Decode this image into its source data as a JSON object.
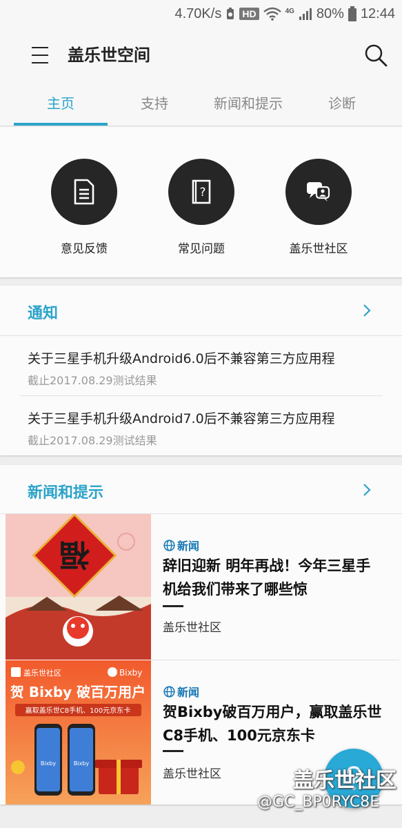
{
  "status_bar": {
    "speed": "4.70K/s",
    "hd": "HD",
    "network": "4G",
    "battery": "80%",
    "time": "12:44"
  },
  "app_bar": {
    "title": "盖乐世空间",
    "menu_icon": "hamburger-menu-icon",
    "search_icon": "search-icon"
  },
  "tabs": [
    {
      "label": "主页",
      "active": true
    },
    {
      "label": "支持",
      "active": false
    },
    {
      "label": "新闻和提示",
      "active": false
    },
    {
      "label": "诊断",
      "active": false
    }
  ],
  "quick_actions": [
    {
      "label": "意见反馈",
      "icon": "feedback-document-icon"
    },
    {
      "label": "常见问题",
      "icon": "faq-book-icon"
    },
    {
      "label": "盖乐世社区",
      "icon": "community-icon"
    }
  ],
  "notices": {
    "title": "通知",
    "items": [
      {
        "title": "关于三星手机升级Android6.0后不兼容第三方应用程",
        "subtitle": "截止2017.08.29测试结果"
      },
      {
        "title": "关于三星手机升级Android7.0后不兼容第三方应用程",
        "subtitle": "截止2017.08.29测试结果"
      }
    ]
  },
  "news": {
    "title": "新闻和提示",
    "items": [
      {
        "tag": "新闻",
        "title": "辞旧迎新 明年再战！今年三星手机给我们带来了哪些惊",
        "source": "盖乐世社区",
        "thumb_char": "福"
      },
      {
        "tag": "新闻",
        "title": "贺Bixby破百万用户，赢取盖乐世C8手机、100元京东卡",
        "source": "盖乐世社区",
        "thumb_brand": "盖乐世社区",
        "thumb_bixby": "Bixby",
        "thumb_headline": "贺 Bixby 破百万用户",
        "thumb_sub": "赢取盖乐世C8手机、100元京东卡",
        "thumb_phone_label": "Bixby"
      }
    ]
  },
  "watermark": {
    "line1": "盖乐世社区",
    "line2": "@GC_BP0RYC8E"
  },
  "colors": {
    "accent": "#2aa3c9",
    "news_tag": "#1677b6",
    "fab": "#28a9d6"
  }
}
